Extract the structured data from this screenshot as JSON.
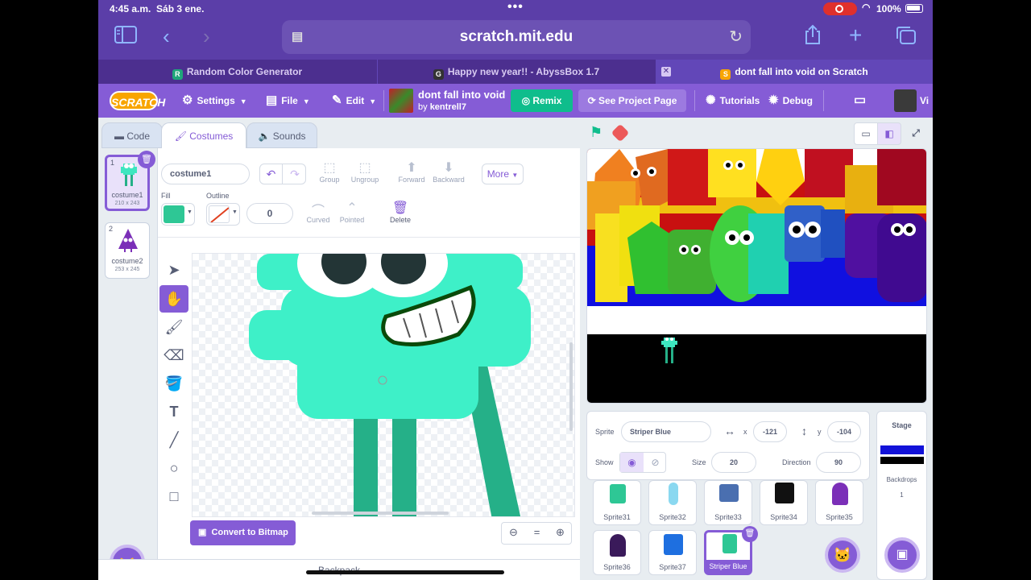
{
  "status": {
    "time": "4:45 a.m.",
    "date": "Sáb 3 ene.",
    "battery": "100%",
    "dots": "•••"
  },
  "browser": {
    "url": "scratch.mit.edu",
    "tabs": [
      {
        "label": "Random Color Generator",
        "fav": "R",
        "fav_color": "#1fa67a"
      },
      {
        "label": "Happy new year!! - AbyssBox 1.7",
        "fav": "G",
        "fav_color": "#333333"
      },
      {
        "label": "dont fall into void on Scratch",
        "fav": "S",
        "fav_color": "#f8a500"
      }
    ]
  },
  "menubar": {
    "logo": "SCRATCH",
    "settings": "Settings",
    "file": "File",
    "edit": "Edit",
    "project_title": "dont fall into void",
    "by": "by",
    "author": "kentrell7",
    "remix": "Remix",
    "see_project": "See Project Page",
    "tutorials": "Tutorials",
    "debug": "Debug",
    "trailing": "Vi"
  },
  "editor_tabs": {
    "code": "Code",
    "costumes": "Costumes",
    "sounds": "Sounds"
  },
  "costumes": [
    {
      "num": "1",
      "name": "costume1",
      "dims": "210 x 243"
    },
    {
      "num": "2",
      "name": "costume2",
      "dims": "253 x 245"
    }
  ],
  "paint": {
    "costume_name": "costume1",
    "group": "Group",
    "ungroup": "Ungroup",
    "forward": "Forward",
    "backward": "Backward",
    "more": "More",
    "fill_label": "Fill",
    "outline_label": "Outline",
    "outline_width": "0",
    "curved": "Curved",
    "pointed": "Pointed",
    "delete": "Delete",
    "fill_color": "#2ec795",
    "convert": "Convert to Bitmap",
    "zoom_out": "−",
    "zoom_reset": "=",
    "zoom_in": "+"
  },
  "backpack": "Backpack",
  "sprite_info": {
    "sprite_label": "Sprite",
    "sprite_name": "Striper Blue",
    "x_label": "x",
    "x": "-121",
    "y_label": "y",
    "y": "-104",
    "show_label": "Show",
    "size_label": "Size",
    "size": "20",
    "direction_label": "Direction",
    "direction": "90"
  },
  "sprites": [
    {
      "name": "Sprite31",
      "color": "#2ec795"
    },
    {
      "name": "Sprite32",
      "color": "#8ad8f0"
    },
    {
      "name": "Sprite33",
      "color": "#4a6fb0"
    },
    {
      "name": "Sprite34",
      "color": "#111111"
    },
    {
      "name": "Sprite35",
      "color": "#7b2fb8"
    },
    {
      "name": "Sprite36",
      "color": "#3a1a5a"
    },
    {
      "name": "Sprite37",
      "color": "#1e6fe0"
    },
    {
      "name": "Striper Blue",
      "color": "#2ec795"
    }
  ],
  "stage_panel": {
    "title": "Stage",
    "backdrops_label": "Backdrops",
    "backdrops_count": "1"
  }
}
